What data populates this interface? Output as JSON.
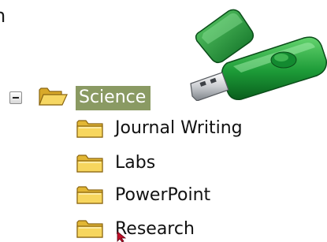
{
  "clipped_text": "n",
  "tree": {
    "root": {
      "label": "Science",
      "expanded": true,
      "selected": true,
      "icon": "folder-open-icon"
    },
    "children": [
      {
        "label": "Journal Writing",
        "icon": "folder-icon"
      },
      {
        "label": "Labs",
        "icon": "folder-icon"
      },
      {
        "label": "PowerPoint",
        "icon": "folder-icon"
      },
      {
        "label": "Research",
        "icon": "folder-icon"
      }
    ]
  },
  "graphic": {
    "name": "usb-flash-drive",
    "color": "#1e9a3a"
  },
  "colors": {
    "selection": "#8a9a63",
    "folder": "#f2cc4a"
  }
}
